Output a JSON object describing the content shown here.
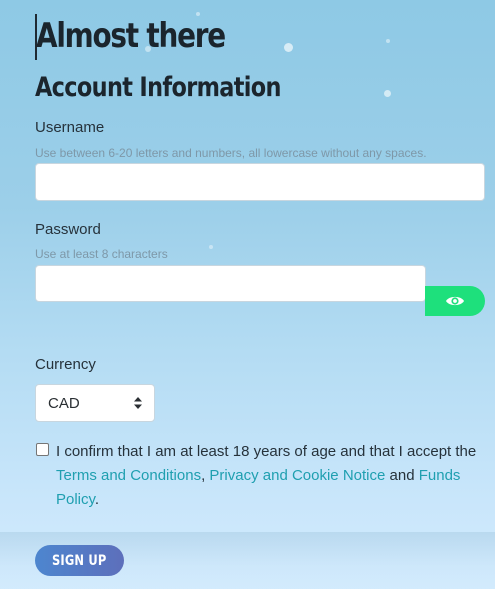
{
  "page": {
    "title": "Almost there",
    "section_title": "Account Information"
  },
  "username": {
    "label": "Username",
    "hint": "Use between 6-20 letters and numbers, all lowercase without any spaces.",
    "value": ""
  },
  "password": {
    "label": "Password",
    "hint": "Use at least 8 characters",
    "value": "",
    "toggle_icon": "eye-icon"
  },
  "currency": {
    "label": "Currency",
    "selected": "CAD"
  },
  "consent": {
    "checked": false,
    "text_before": "I confirm that I am at least 18 years of age and that I accept the ",
    "terms_link": "Terms and Conditions",
    "separator": ", ",
    "privacy_link": "Privacy and Cookie Notice",
    "and_text": " and ",
    "funds_link": "Funds Policy",
    "text_after": "."
  },
  "signup": {
    "label": "SIGN UP"
  },
  "colors": {
    "accent_green": "#1ee07c",
    "link_teal": "#1f9fb0",
    "button_blue": "#4d86cf"
  }
}
